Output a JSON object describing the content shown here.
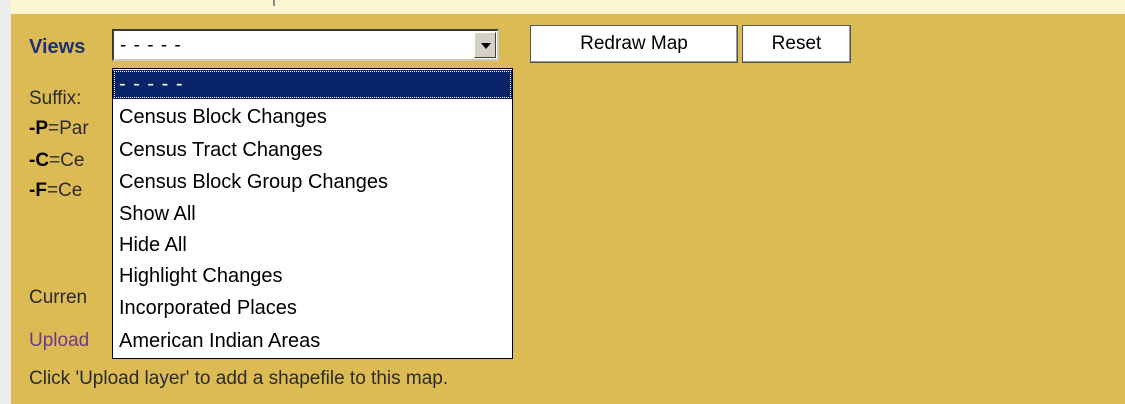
{
  "views": {
    "label": "Views",
    "selected_value": "- - - - -",
    "options": [
      "- - - - -",
      "Census Block Changes",
      "Census Tract Changes",
      "Census Block Group Changes",
      "Show All",
      "Hide All",
      "Highlight Changes",
      "Incorporated Places",
      "American Indian Areas"
    ]
  },
  "buttons": {
    "redraw": "Redraw Map",
    "reset": "Reset"
  },
  "legend": {
    "suffix_label": "Suffix:",
    "p_key": "-P",
    "p_text": "=Par",
    "c_key": "-C",
    "c_text": "=Ce",
    "f_key": "-F",
    "f_text": "=Ce"
  },
  "current_fragment": "Curren",
  "upload_fragment": "Upload",
  "upload_instruction": "Click 'Upload layer' to add a shapefile to this map.",
  "colors": {
    "background": "#dcbb55",
    "selection": "#0a246a",
    "views_label": "#1f2f78",
    "upload_link": "#6a3c88"
  }
}
